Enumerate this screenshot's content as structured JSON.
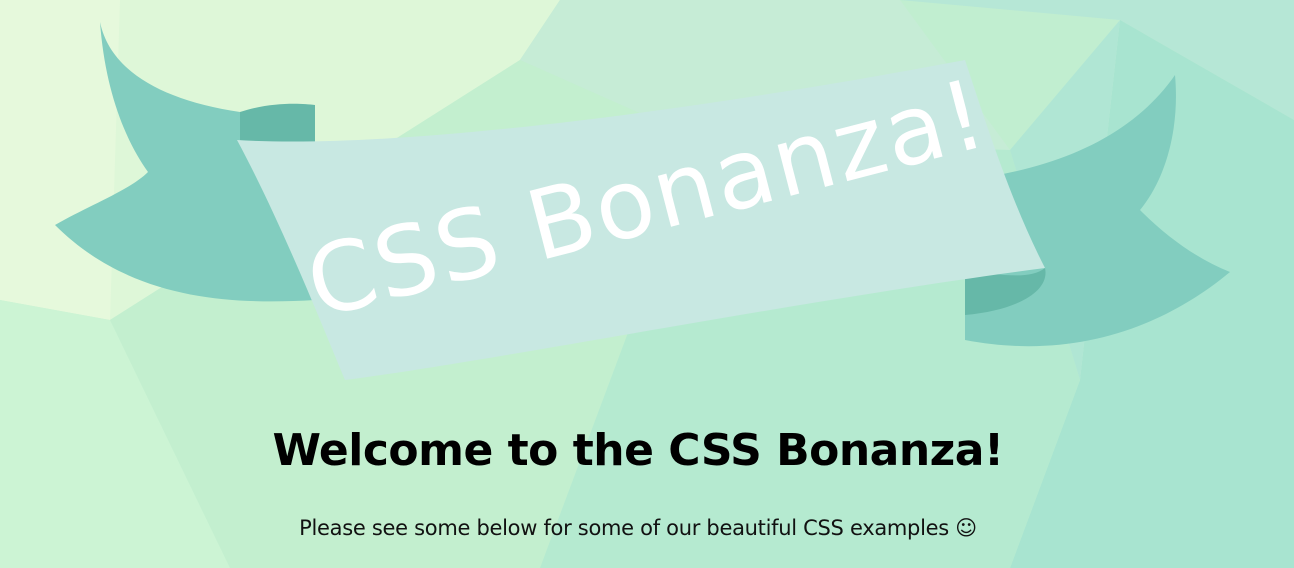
{
  "banner": {
    "text": "CSS Bonanza!",
    "ribbon_color": "#c8e8e2",
    "tail_color": "#82cdbf",
    "fold_color": "#66b8a8"
  },
  "page": {
    "heading": "Welcome to the CSS Bonanza!",
    "subtitle": "Please see some below for some of our beautiful CSS examples ☺"
  },
  "colors": {
    "background": "#bdeccd",
    "background_light": "#e3f8da",
    "background_teal": "#a9e5d3"
  }
}
